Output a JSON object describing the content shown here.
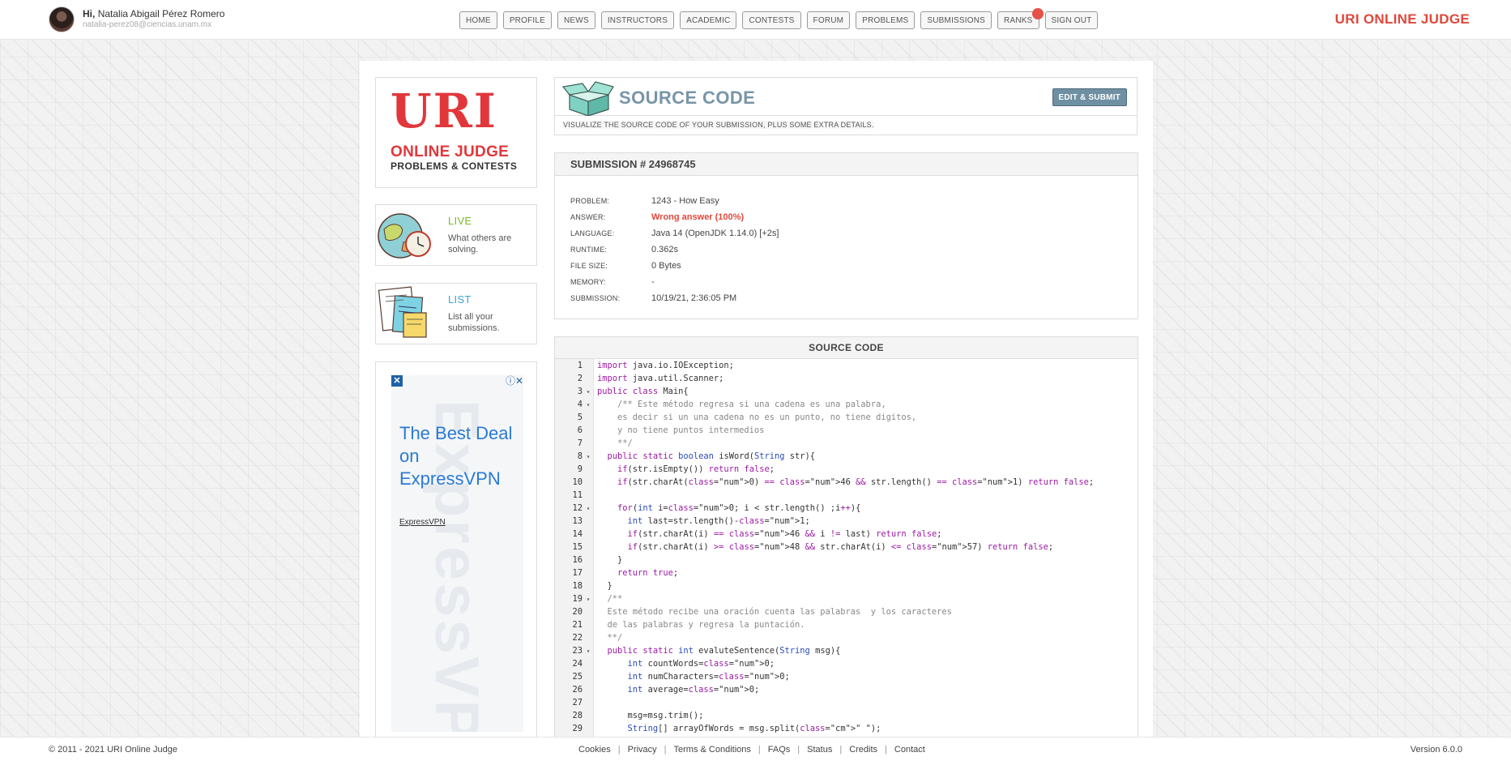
{
  "user": {
    "greeting": "Hi,",
    "name": "Natalia Abigail Pérez Romero",
    "email": "natalia-perez08@ciencias.unam.mx"
  },
  "nav": [
    "HOME",
    "PROFILE",
    "NEWS",
    "INSTRUCTORS",
    "ACADEMIC",
    "CONTESTS",
    "FORUM",
    "PROBLEMS",
    "SUBMISSIONS",
    "RANKS",
    "SIGN OUT"
  ],
  "brand": "URI ONLINE JUDGE",
  "logo": {
    "uri": "URI",
    "online_judge": "ONLINE JUDGE",
    "problems_contests": "PROBLEMS & CONTESTS"
  },
  "side": {
    "live_title": "LIVE",
    "live_desc": "What others are solving.",
    "list_title": "LIST",
    "list_desc": "List all your submissions."
  },
  "ad": {
    "close": "✕",
    "info": "ⓘ✕",
    "watermark": "ExpressVPN",
    "headline": "The Best Deal on ExpressVPN",
    "brand": "ExpressVPN"
  },
  "source_header": {
    "title": "SOURCE CODE",
    "button": "EDIT & SUBMIT",
    "subtitle": "VISUALIZE THE SOURCE CODE OF YOUR SUBMISSION, PLUS SOME EXTRA DETAILS."
  },
  "submission": {
    "title": "SUBMISSION # 24968745",
    "rows": [
      {
        "key": "PROBLEM:",
        "value": "1243 - How Easy"
      },
      {
        "key": "ANSWER:",
        "value": "Wrong answer (100%)"
      },
      {
        "key": "LANGUAGE:",
        "value": "Java 14 (OpenJDK 1.14.0) [+2s]"
      },
      {
        "key": "RUNTIME:",
        "value": "0.362s"
      },
      {
        "key": "FILE SIZE:",
        "value": "0 Bytes"
      },
      {
        "key": "MEMORY:",
        "value": "-"
      },
      {
        "key": "SUBMISSION:",
        "value": "10/19/21, 2:36:05 PM"
      }
    ]
  },
  "code": {
    "title": "SOURCE CODE",
    "lines": [
      {
        "n": "1",
        "fold": "",
        "text": "import java.io.IOException;"
      },
      {
        "n": "2",
        "fold": "",
        "text": "import java.util.Scanner;"
      },
      {
        "n": "3",
        "fold": "▾",
        "text": "public class Main{"
      },
      {
        "n": "4",
        "fold": "▾",
        "text": "    /** Este método regresa si una cadena es una palabra,"
      },
      {
        "n": "5",
        "fold": "",
        "text": "    es decir si un una cadena no es un punto, no tiene digitos,"
      },
      {
        "n": "6",
        "fold": "",
        "text": "    y no tiene puntos intermedios"
      },
      {
        "n": "7",
        "fold": "",
        "text": "    **/"
      },
      {
        "n": "8",
        "fold": "▾",
        "text": "  public static boolean isWord(String str){"
      },
      {
        "n": "9",
        "fold": "",
        "text": "    if(str.isEmpty()) return false;"
      },
      {
        "n": "10",
        "fold": "",
        "text": "    if(str.charAt(0) == 46 && str.length() == 1) return false;"
      },
      {
        "n": "11",
        "fold": "",
        "text": ""
      },
      {
        "n": "12",
        "fold": "▾",
        "text": "    for(int i=0; i < str.length() ;i++){"
      },
      {
        "n": "13",
        "fold": "",
        "text": "      int last=str.length()-1;"
      },
      {
        "n": "14",
        "fold": "",
        "text": "      if(str.charAt(i) == 46 && i != last) return false;"
      },
      {
        "n": "15",
        "fold": "",
        "text": "      if(str.charAt(i) >= 48 && str.charAt(i) <= 57) return false;"
      },
      {
        "n": "16",
        "fold": "",
        "text": "    }"
      },
      {
        "n": "17",
        "fold": "",
        "text": "    return true;"
      },
      {
        "n": "18",
        "fold": "",
        "text": "  }"
      },
      {
        "n": "19",
        "fold": "▾",
        "text": "  /**"
      },
      {
        "n": "20",
        "fold": "",
        "text": "  Este método recibe una oración cuenta las palabras  y los caracteres"
      },
      {
        "n": "21",
        "fold": "",
        "text": "  de las palabras y regresa la puntación."
      },
      {
        "n": "22",
        "fold": "",
        "text": "  **/"
      },
      {
        "n": "23",
        "fold": "▾",
        "text": "  public static int evaluteSentence(String msg){"
      },
      {
        "n": "24",
        "fold": "",
        "text": "      int countWords=0;"
      },
      {
        "n": "25",
        "fold": "",
        "text": "      int numCharacters=0;"
      },
      {
        "n": "26",
        "fold": "",
        "text": "      int average=0;"
      },
      {
        "n": "27",
        "fold": "",
        "text": ""
      },
      {
        "n": "28",
        "fold": "",
        "text": "      msg=msg.trim();"
      },
      {
        "n": "29",
        "fold": "",
        "text": "      String[] arrayOfWords = msg.split(\" \");"
      }
    ]
  },
  "footer": {
    "copyright": "© 2011 - 2021 URI Online Judge",
    "links": [
      "Cookies",
      "Privacy",
      "Terms & Conditions",
      "FAQs",
      "Status",
      "Credits",
      "Contact"
    ],
    "version": "Version 6.0.0"
  },
  "colors": {
    "brand_red": "#e1473b",
    "live_green": "#7cba2c",
    "list_blue": "#3aa3d6",
    "title_steel": "#7895a8"
  }
}
